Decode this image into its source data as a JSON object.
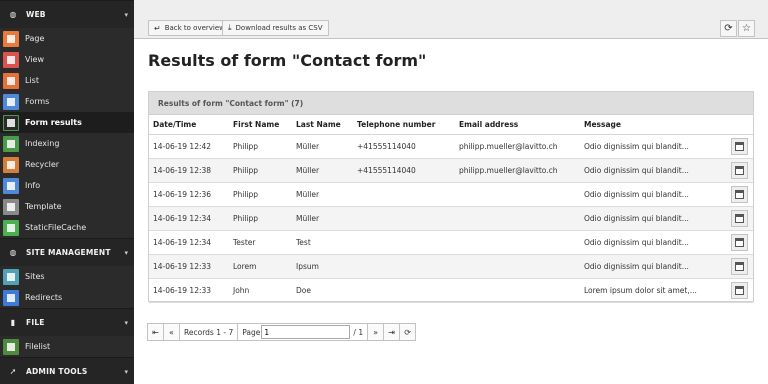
{
  "sidebar": {
    "sections": [
      {
        "title": "WEB",
        "icon": "globe-icon",
        "items": [
          {
            "label": "Page",
            "color": "#e87a3e",
            "icon": "page-icon"
          },
          {
            "label": "View",
            "color": "#d9534f",
            "icon": "eye-icon"
          },
          {
            "label": "List",
            "color": "#e8703a",
            "icon": "list-icon"
          },
          {
            "label": "Forms",
            "color": "#4f8ad9",
            "icon": "forms-icon"
          },
          {
            "label": "Form results",
            "color": "#2a2a2a",
            "icon": "form-results-icon",
            "active": true
          },
          {
            "label": "Indexing",
            "color": "#4a9b4a",
            "icon": "indexing-icon"
          },
          {
            "label": "Recycler",
            "color": "#d5803a",
            "icon": "recycler-icon"
          },
          {
            "label": "Info",
            "color": "#4f8ad9",
            "icon": "info-icon"
          },
          {
            "label": "Template",
            "color": "#8a8a8a",
            "icon": "template-icon"
          },
          {
            "label": "StaticFileCache",
            "color": "#4caf50",
            "icon": "static-file-cache-icon"
          }
        ]
      },
      {
        "title": "SITE MANAGEMENT",
        "icon": "globe-icon",
        "items": [
          {
            "label": "Sites",
            "color": "#4fa3b5",
            "icon": "sites-icon"
          },
          {
            "label": "Redirects",
            "color": "#3e7bd4",
            "icon": "redirects-icon"
          }
        ]
      },
      {
        "title": "FILE",
        "icon": "file-icon",
        "items": [
          {
            "label": "Filelist",
            "color": "#4f8a3e",
            "icon": "filelist-icon"
          }
        ]
      },
      {
        "title": "ADMIN TOOLS",
        "icon": "rocket-icon",
        "items": []
      }
    ]
  },
  "toolbar": {
    "back_label": "Back to overview",
    "download_label": "Download results as CSV",
    "back_icon": "↵",
    "download_icon": "⤓",
    "reload_icon": "⟳",
    "bookmark_icon": "☆"
  },
  "page": {
    "title": "Results of form \"Contact form\""
  },
  "panel": {
    "heading": "Results of form \"Contact form\" (7)"
  },
  "table": {
    "columns": [
      "Date/Time",
      "First Name",
      "Last Name",
      "Telephone number",
      "Email address",
      "Message"
    ],
    "rows": [
      {
        "date": "14-06-19 12:42",
        "first": "Philipp",
        "last": "Müller",
        "phone": "+41555114040",
        "email": "philipp.mueller@lavitto.ch",
        "message": "Odio dignissim qui blandit..."
      },
      {
        "date": "14-06-19 12:38",
        "first": "Philipp",
        "last": "Müller",
        "phone": "+41555114040",
        "email": "philipp.mueller@lavitto.ch",
        "message": "Odio dignissim qui blandit..."
      },
      {
        "date": "14-06-19 12:36",
        "first": "Philipp",
        "last": "Müller",
        "phone": "",
        "email": "",
        "message": "Odio dignissim qui blandit..."
      },
      {
        "date": "14-06-19 12:34",
        "first": "Philipp",
        "last": "Müller",
        "phone": "",
        "email": "",
        "message": "Odio dignissim qui blandit..."
      },
      {
        "date": "14-06-19 12:34",
        "first": "Tester",
        "last": "Test",
        "phone": "",
        "email": "",
        "message": "Odio dignissim qui blandit..."
      },
      {
        "date": "14-06-19 12:33",
        "first": "Lorem",
        "last": "Ipsum",
        "phone": "",
        "email": "",
        "message": "Odio dignissim qui blandit..."
      },
      {
        "date": "14-06-19 12:33",
        "first": "John",
        "last": "Doe",
        "phone": "",
        "email": "",
        "message": "Lorem ipsum dolor sit amet,..."
      }
    ]
  },
  "pagination": {
    "first_icon": "⇤",
    "prev_icon": "«",
    "records_label": "Records 1 - 7",
    "page_label": "Page",
    "page_value": "1",
    "total_label": "/ 1",
    "next_icon": "»",
    "last_icon": "⇥",
    "reload_icon": "⟳"
  }
}
